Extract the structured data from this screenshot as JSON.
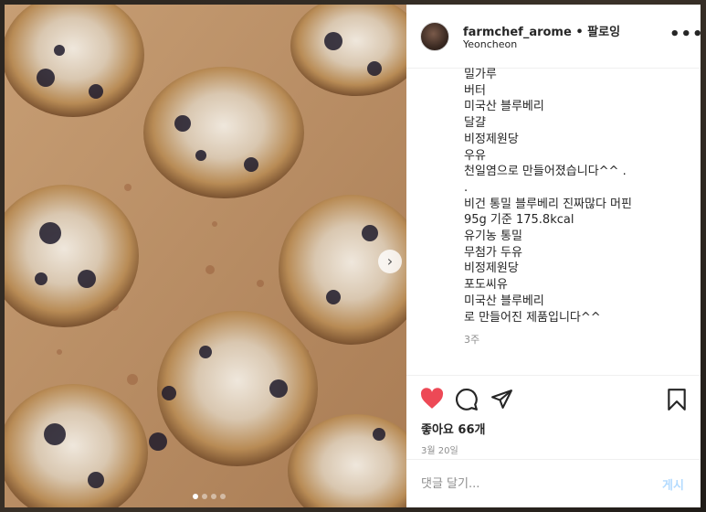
{
  "header": {
    "username": "farmchef_arome",
    "separator": " • ",
    "follow_label": "팔로잉",
    "location": "Yeoncheon",
    "more_icon": "more-horizontal-icon"
  },
  "caption": {
    "lines": [
      "밀가루",
      "버터",
      "미국산 블루베리",
      "달걀",
      "비정제원당",
      "우유",
      "천일염으로 만들어졌습니다^^ .",
      ".",
      "비건 통밀 블루베리 진짜많다 머핀",
      "95g 기준 175.8kcal",
      "유기농 통밀",
      "무첨가 두유",
      "비정제원당",
      "포도씨유",
      "미국산 블루베리",
      "로 만들어진 제품입니다^^"
    ],
    "time_ago": "3주"
  },
  "actions": {
    "like_icon": "heart-filled-icon",
    "comment_icon": "comment-icon",
    "share_icon": "share-icon",
    "save_icon": "bookmark-icon",
    "likes": "좋아요 66개",
    "date": "3월 20일",
    "like_color": "#ed4956"
  },
  "comment": {
    "placeholder": "댓글 달기...",
    "post_label": "게시"
  },
  "carousel": {
    "dots": 4,
    "active_dot": 1
  }
}
